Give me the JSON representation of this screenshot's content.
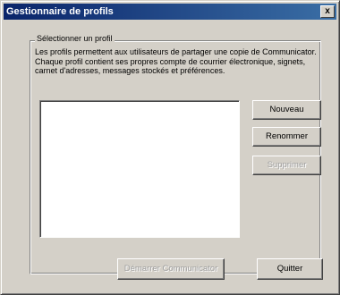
{
  "window": {
    "title": "Gestionnaire de profils",
    "close_label": "x"
  },
  "group": {
    "label": "Sélectionner un profil",
    "description": "Les profils permettent aux utilisateurs de partager une copie de Communicator. Chaque profil contient ses propres compte de courrier électronique, signets, carnet d'adresses, messages stockés et préférences."
  },
  "profiles": [],
  "buttons": {
    "new": "Nouveau",
    "rename": "Renommer",
    "delete": "Supprimer",
    "start": "Démarrer Communicator",
    "quit": "Quitter"
  },
  "colors": {
    "titlebar_start": "#0a246a",
    "titlebar_end": "#3a6ea5",
    "face": "#d4d0c8"
  }
}
